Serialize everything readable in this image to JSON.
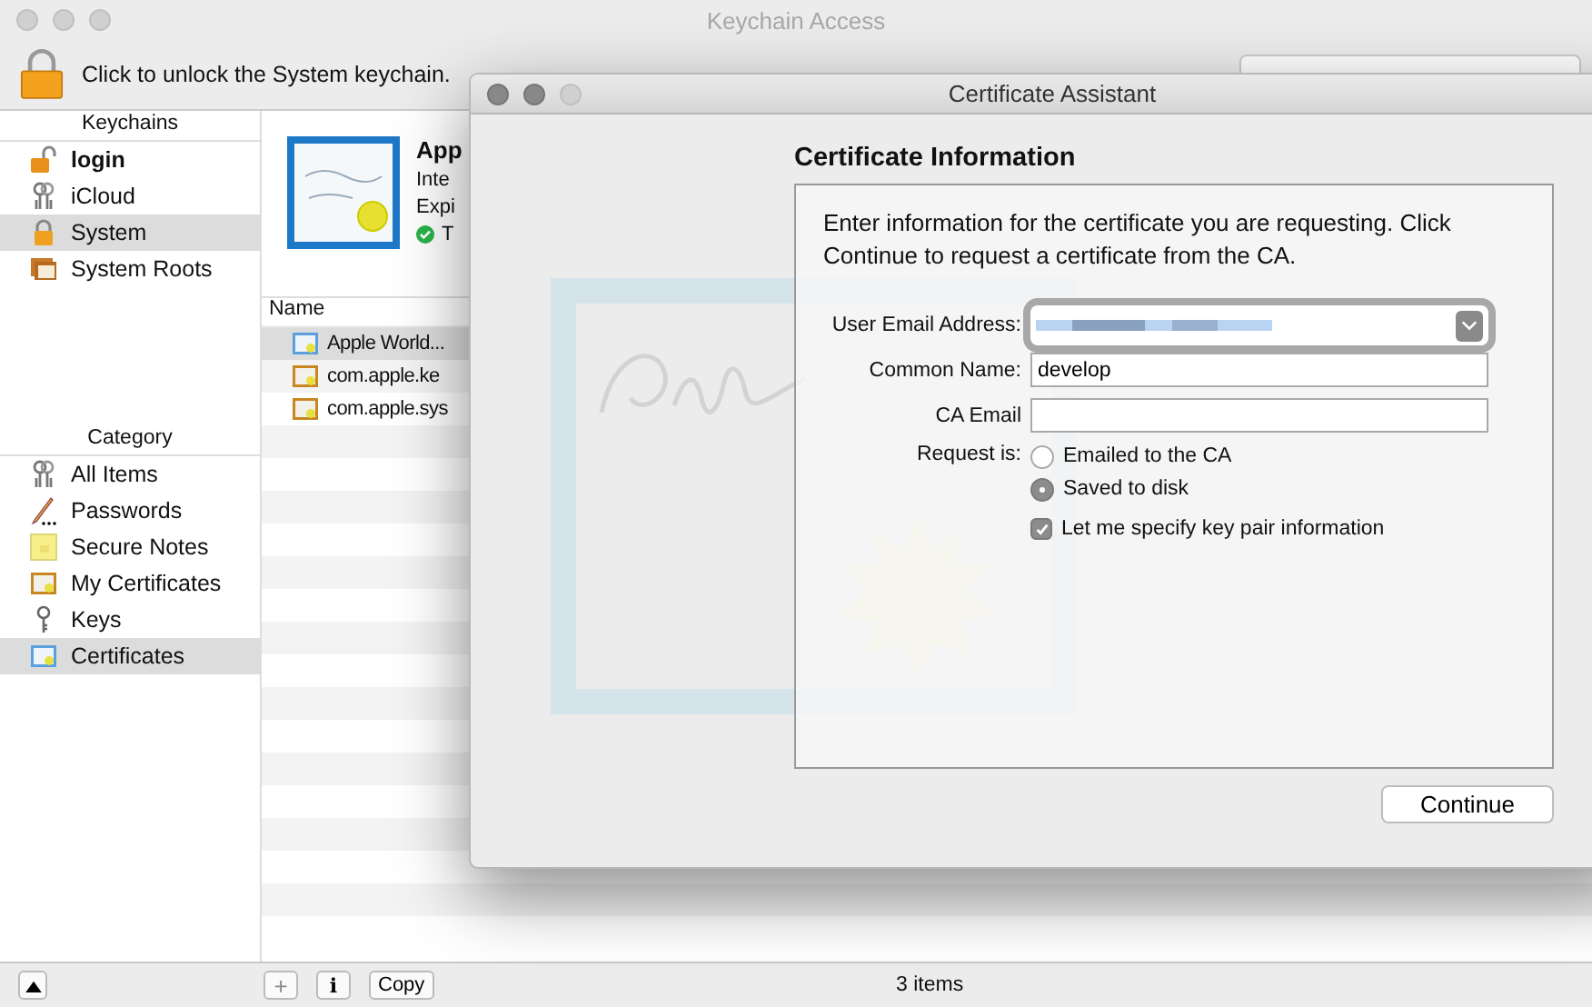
{
  "window": {
    "title": "Keychain Access"
  },
  "toolbar": {
    "lock_message": "Click to unlock the System keychain.",
    "locked": true
  },
  "keychains": {
    "header": "Keychains",
    "items": [
      {
        "label": "login",
        "kind": "unlocked",
        "bold": true,
        "selected": false
      },
      {
        "label": "iCloud",
        "kind": "keys",
        "bold": false,
        "selected": false
      },
      {
        "label": "System",
        "kind": "locked",
        "bold": false,
        "selected": true
      },
      {
        "label": "System Roots",
        "kind": "certs",
        "bold": false,
        "selected": false
      }
    ]
  },
  "category": {
    "header": "Category",
    "items": [
      {
        "label": "All Items",
        "kind": "keys",
        "selected": false
      },
      {
        "label": "Passwords",
        "kind": "pencil",
        "selected": false
      },
      {
        "label": "Secure Notes",
        "kind": "note",
        "selected": false
      },
      {
        "label": "My Certificates",
        "kind": "mycert",
        "selected": false
      },
      {
        "label": "Keys",
        "kind": "key",
        "selected": false
      },
      {
        "label": "Certificates",
        "kind": "cert",
        "selected": true
      }
    ]
  },
  "detail": {
    "title": "App",
    "line_1": "Inte",
    "line_2": "Expi",
    "status": "T"
  },
  "table": {
    "columns": [
      "Name"
    ],
    "rows": [
      {
        "name": "Apple World...",
        "kind": "cert",
        "selected": true
      },
      {
        "name": "com.apple.ke",
        "kind": "mycert",
        "selected": false
      },
      {
        "name": "com.apple.sys",
        "kind": "mycert",
        "selected": false
      }
    ]
  },
  "bottom_bar": {
    "add": "+",
    "info": "i",
    "copy": "Copy",
    "count": "3 items"
  },
  "dialog": {
    "title": "Certificate Assistant",
    "heading": "Certificate Information",
    "intro": "Enter information for the certificate you are requesting. Click Continue to request a certificate from the CA.",
    "fields": [
      {
        "label": "User Email Address:",
        "kind": "combo",
        "focused": true
      },
      {
        "label": "Common Name:",
        "kind": "text",
        "value": "develop",
        "focused": false
      },
      {
        "label": "CA Email",
        "kind": "text",
        "focused": false
      }
    ],
    "request_label": "Request is:",
    "options": [
      {
        "label": "Emailed to the CA",
        "selected": false
      },
      {
        "label": "Saved to disk",
        "selected": true
      }
    ],
    "checkbox": {
      "label": "Let me specify key pair information",
      "checked": true
    },
    "continue": "Continue"
  }
}
